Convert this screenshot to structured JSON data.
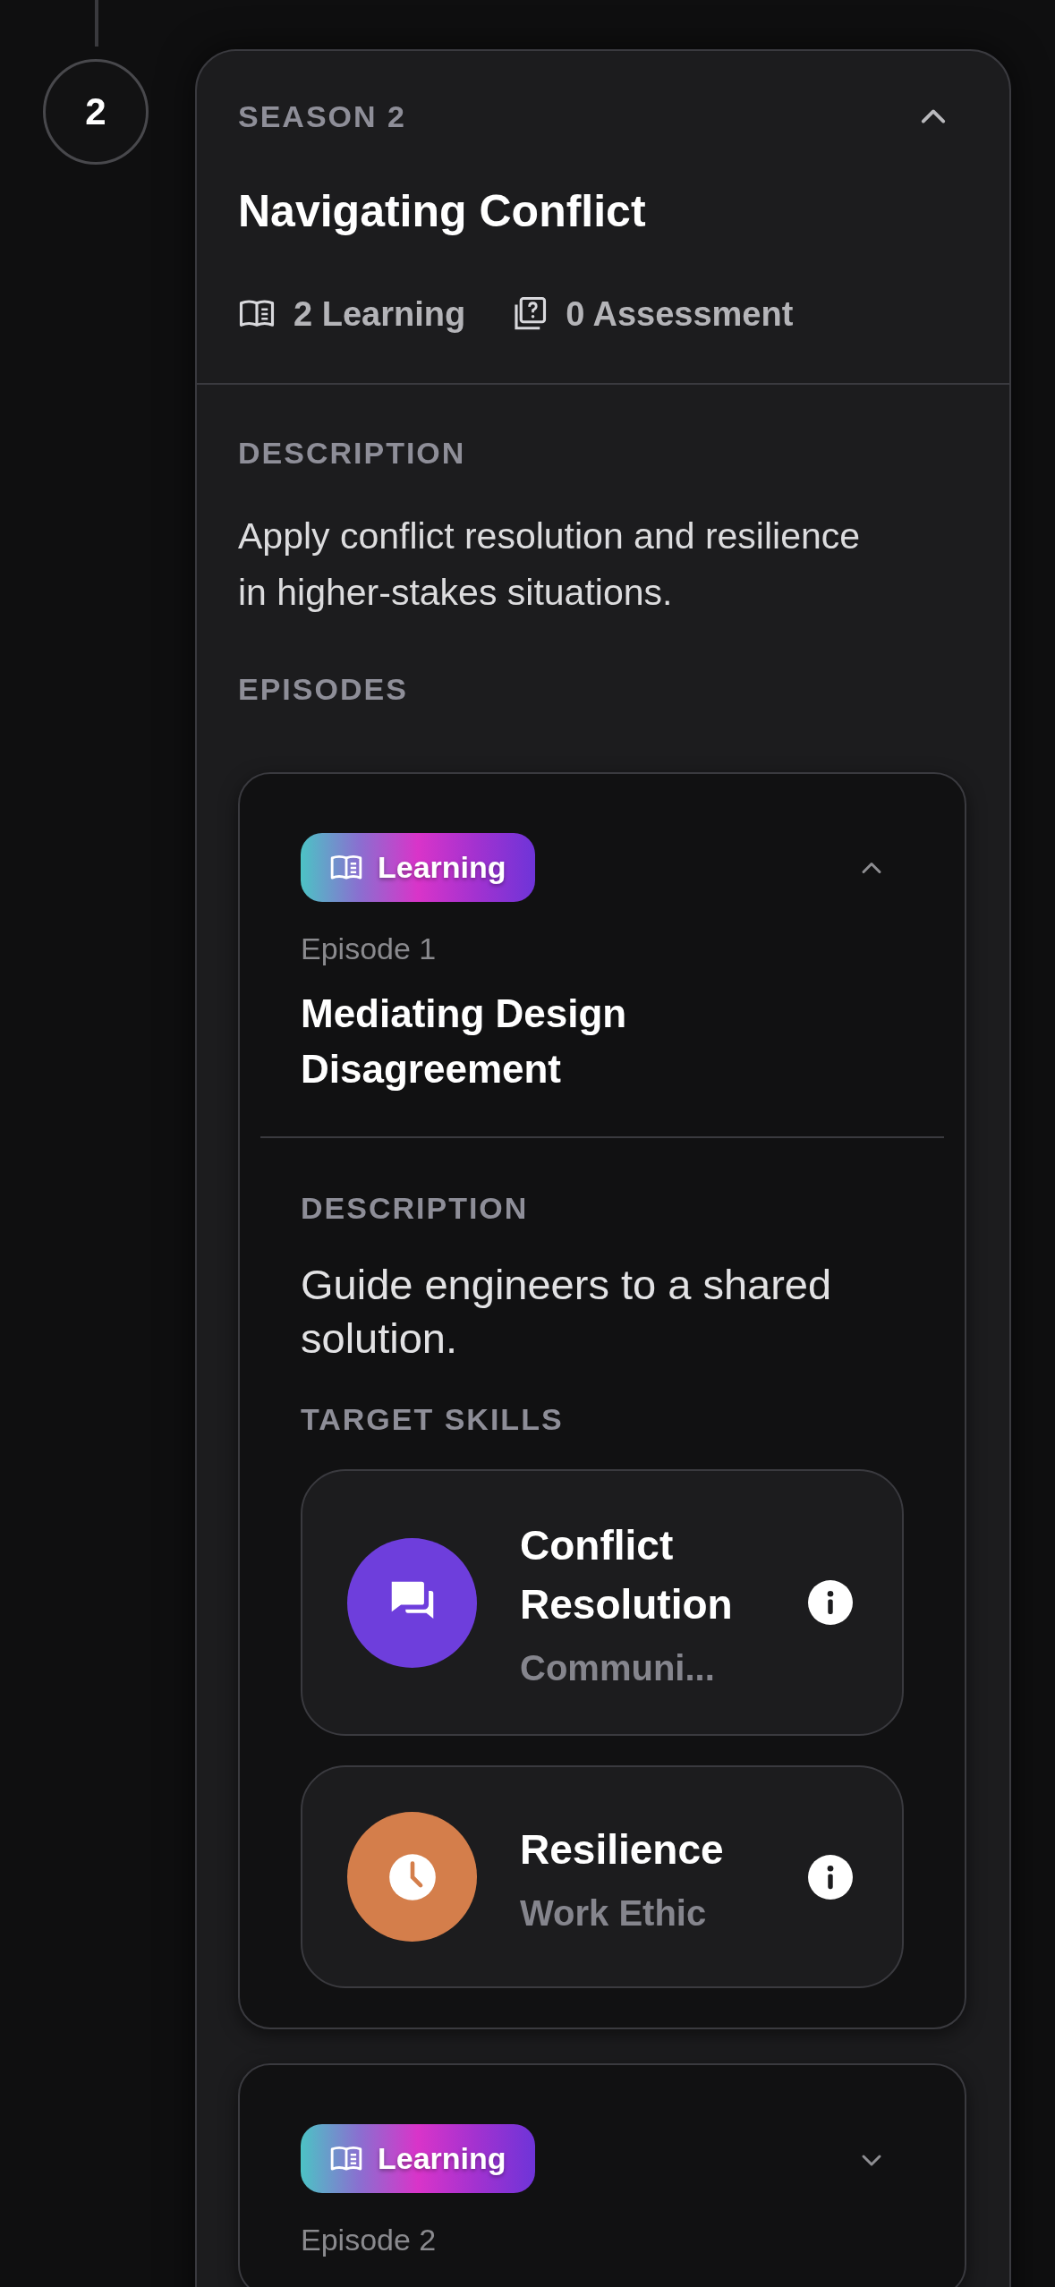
{
  "timeline": {
    "step": "2"
  },
  "season": {
    "label": "SEASON 2",
    "expanded": true,
    "title": "Navigating Conflict",
    "stats": [
      {
        "kind": "learning",
        "text": "2 Learning"
      },
      {
        "kind": "assessment",
        "text": "0 Assessment"
      }
    ],
    "description_label": "DESCRIPTION",
    "description": "Apply conflict resolution and resilience in higher-stakes situations.",
    "episodes_label": "EPISODES",
    "episodes": [
      {
        "badge": {
          "kind": "learning",
          "label": "Learning"
        },
        "expanded": true,
        "number": "Episode 1",
        "title": "Mediating Design Disagreement",
        "description_label": "DESCRIPTION",
        "description": "Guide engineers to a shared solution.",
        "skills_label": "TARGET SKILLS",
        "skills": [
          {
            "name": "Conflict Resolution",
            "category": "Communi...",
            "kind": "chat",
            "color": "#6e3edc"
          },
          {
            "name": "Resilience",
            "category": "Work Ethic",
            "kind": "clock",
            "color": "#d47e4b"
          }
        ]
      },
      {
        "badge": {
          "kind": "learning",
          "label": "Learning"
        },
        "expanded": false,
        "number": "Episode 2"
      }
    ]
  }
}
